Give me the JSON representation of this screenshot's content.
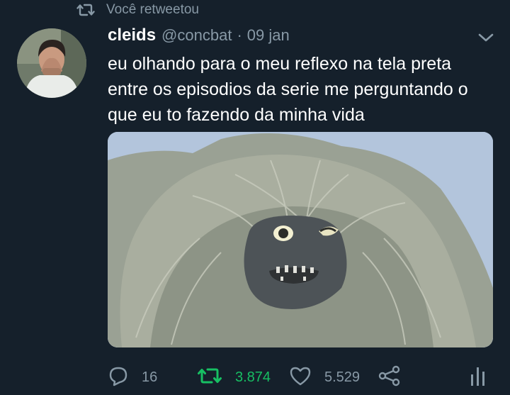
{
  "retweet_context": {
    "icon": "retweet-icon",
    "text": "Você retweetou"
  },
  "tweet": {
    "display_name": "cleids",
    "handle": "@concbat",
    "separator": "·",
    "date": "09 jan",
    "text": "eu olhando para o meu reflexo na tela preta entre os episodios da serie me perguntando o que eu to fazendo da minha vida",
    "media": {
      "description_icon": "photo"
    }
  },
  "actions": {
    "reply": {
      "icon": "reply-icon",
      "count": "16"
    },
    "retweet": {
      "icon": "retweet-icon",
      "count": "3.874",
      "active": true
    },
    "like": {
      "icon": "heart-icon",
      "count": "5.529"
    },
    "share": {
      "icon": "share-icon"
    },
    "analytics": {
      "icon": "analytics-icon"
    }
  },
  "colors": {
    "background": "#15202b",
    "primary_text": "#ffffff",
    "secondary_text": "#8899a6",
    "retweet_active": "#17bf63"
  }
}
